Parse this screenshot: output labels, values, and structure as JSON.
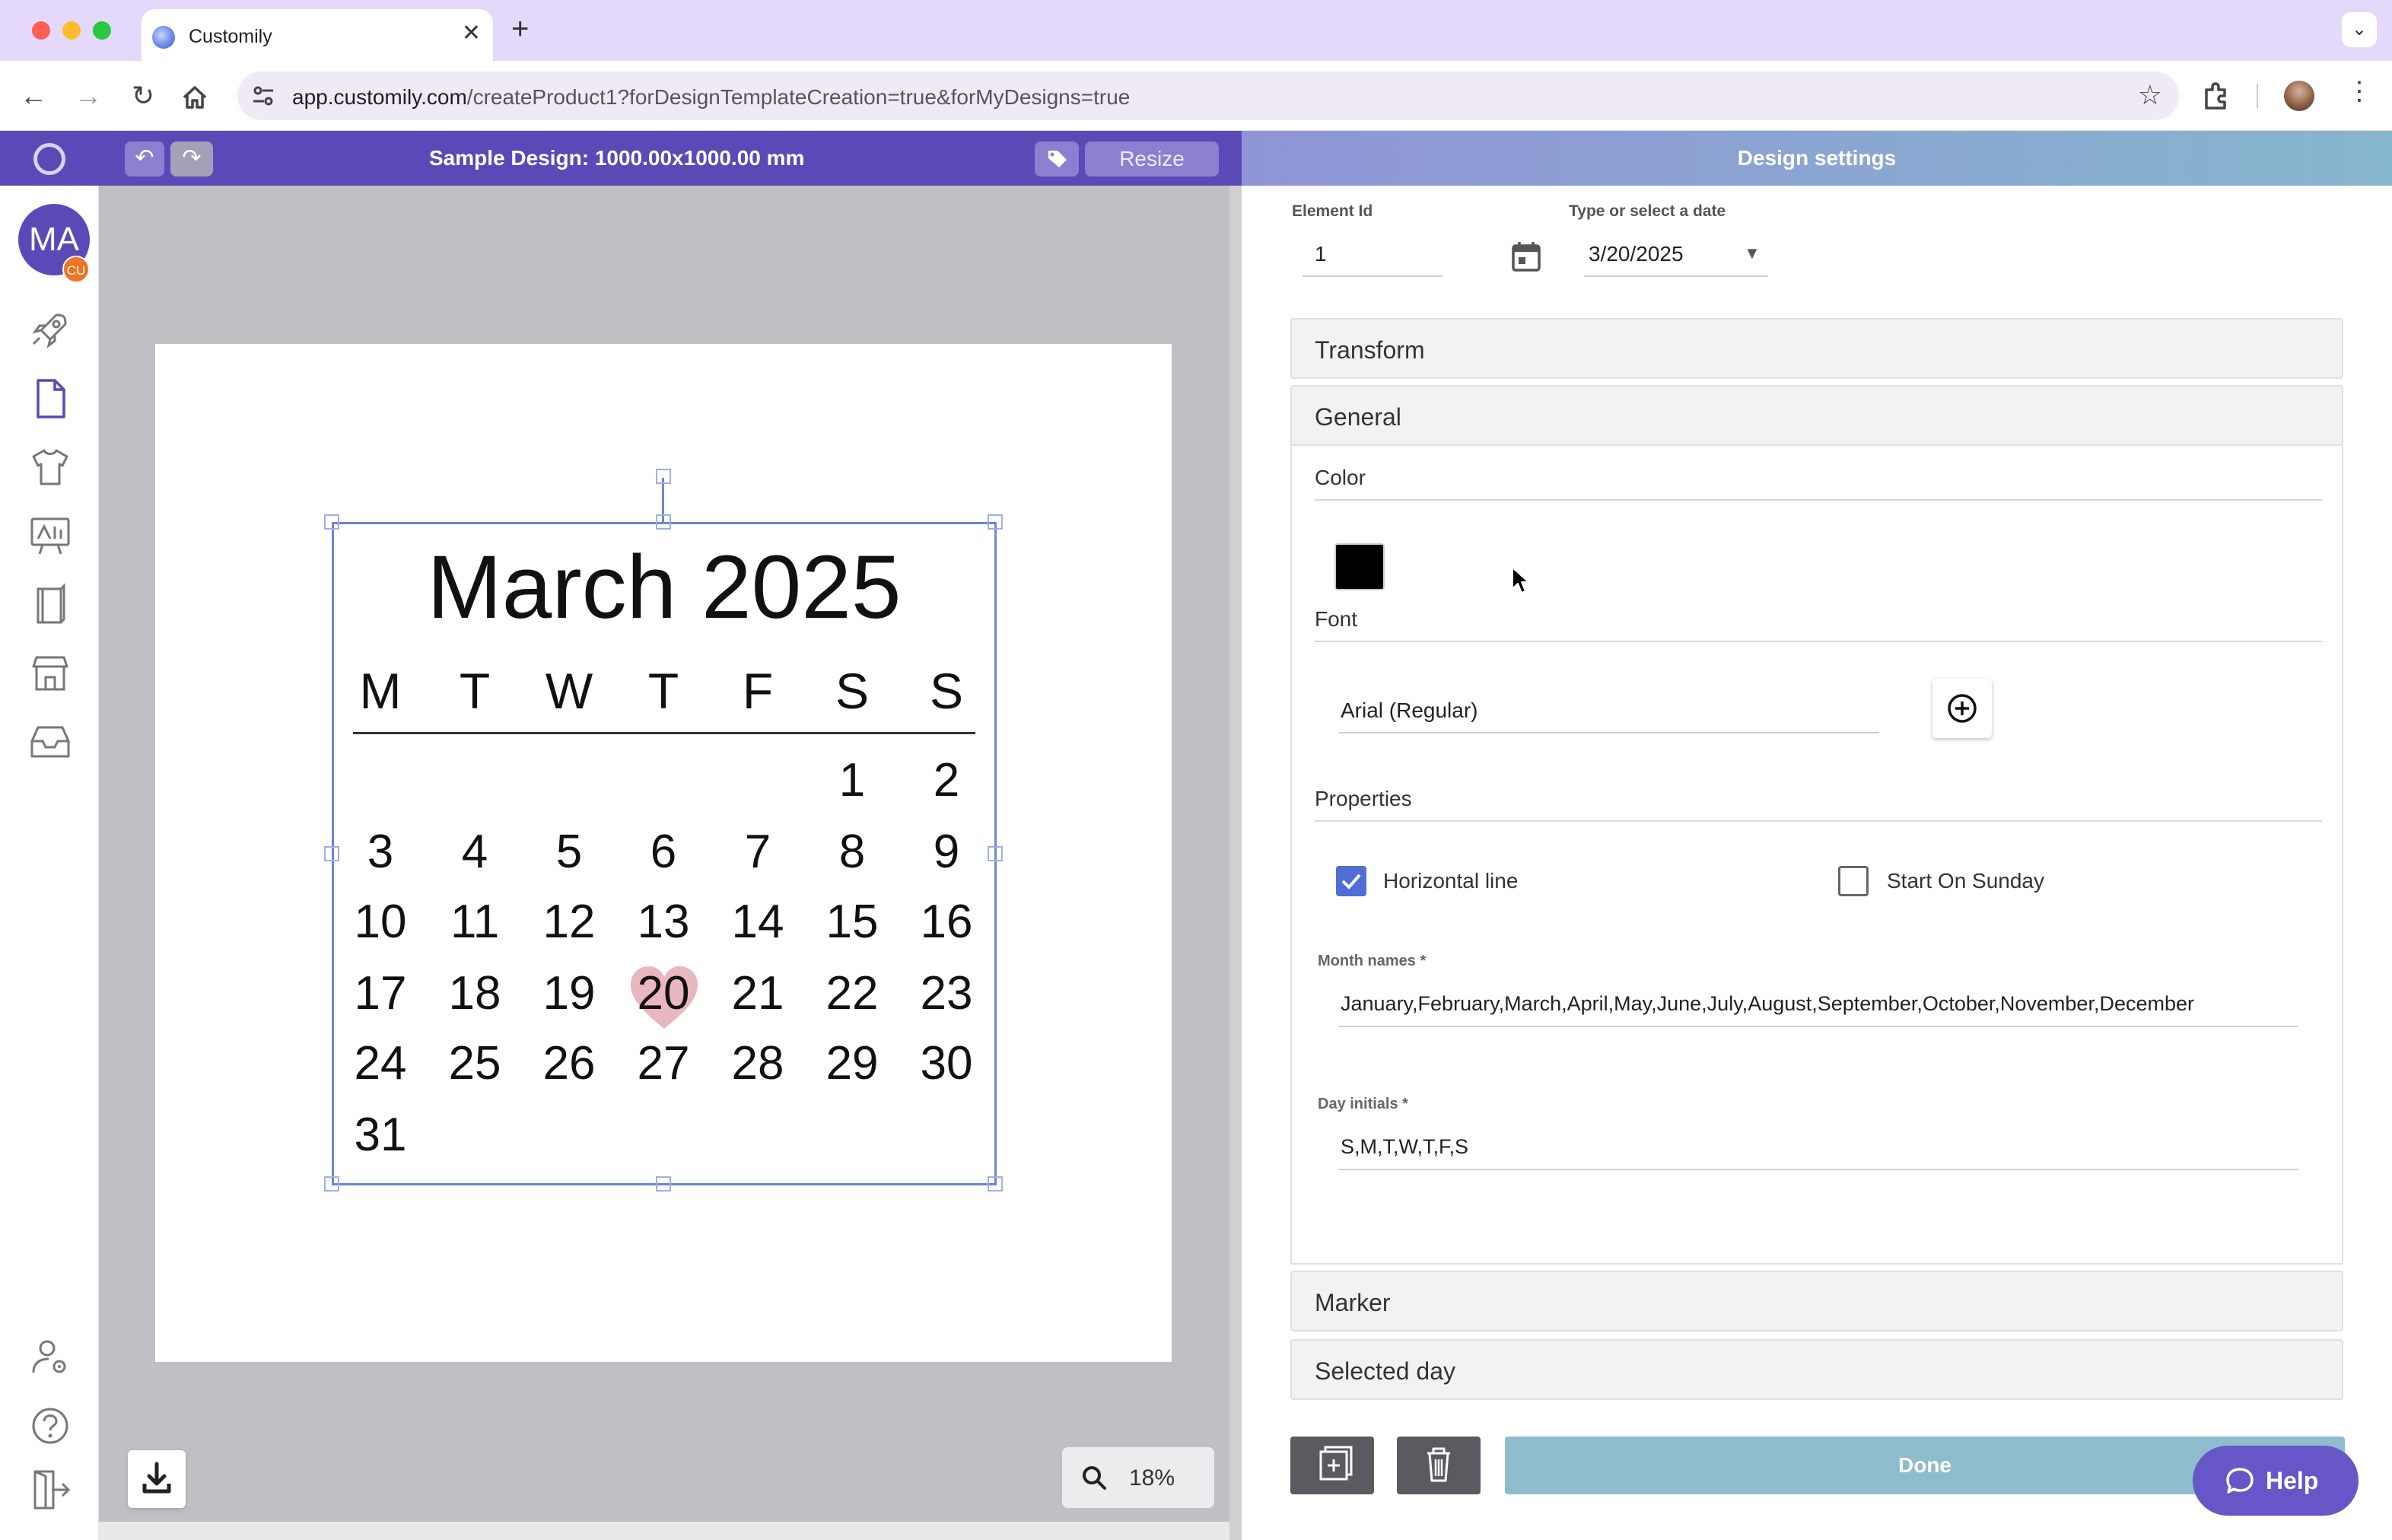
{
  "browser": {
    "tab_title": "Customily",
    "url_host": "app.customily.com",
    "url_path": "/createProduct1?forDesignTemplateCreation=true&forMyDesigns=true",
    "new_tab_symbol": "+",
    "tab_close_symbol": "✕"
  },
  "header": {
    "design_title": "Sample Design: 1000.00x1000.00 mm",
    "resize_label": "Resize",
    "settings_title": "Design settings"
  },
  "sidebar": {
    "avatar_initials": "MA",
    "avatar_badge": "CU",
    "items": [
      "rocket-icon",
      "document-icon",
      "tshirt-icon",
      "canvas-art-icon",
      "book-icon",
      "store-icon",
      "inbox-icon"
    ],
    "bottom_items": [
      "user-settings-icon",
      "help-circle-icon",
      "logout-icon"
    ]
  },
  "calendar": {
    "title": "March 2025",
    "day_initials": [
      "M",
      "T",
      "W",
      "T",
      "F",
      "S",
      "S"
    ],
    "weeks": [
      [
        "",
        "",
        "",
        "",
        "",
        "1",
        "2"
      ],
      [
        "3",
        "4",
        "5",
        "6",
        "7",
        "8",
        "9"
      ],
      [
        "10",
        "11",
        "12",
        "13",
        "14",
        "15",
        "16"
      ],
      [
        "17",
        "18",
        "19",
        "20",
        "21",
        "22",
        "23"
      ],
      [
        "24",
        "25",
        "26",
        "27",
        "28",
        "29",
        "30"
      ],
      [
        "31",
        "",
        "",
        "",
        "",
        "",
        ""
      ]
    ],
    "highlighted_day": "20",
    "highlight_color": "#e9b7c0"
  },
  "canvas": {
    "zoom": "18%"
  },
  "settings": {
    "element_id_label": "Element Id",
    "element_id_value": "1",
    "date_label": "Type or select a date",
    "date_value": "3/20/2025",
    "sections": {
      "transform": "Transform",
      "general": "General",
      "marker": "Marker",
      "selected_day": "Selected day"
    },
    "color_label": "Color",
    "color_value": "#000000",
    "font_label": "Font",
    "font_value": "Arial (Regular)",
    "properties_label": "Properties",
    "horizontal_line_label": "Horizontal line",
    "horizontal_line_checked": true,
    "start_on_sunday_label": "Start On Sunday",
    "start_on_sunday_checked": false,
    "month_names_label": "Month names *",
    "month_names_value": "January,February,March,April,May,June,July,August,September,October,November,December",
    "day_initials_label": "Day initials *",
    "day_initials_value": "S,M,T,W,T,F,S",
    "done_label": "Done",
    "help_label": "Help"
  },
  "colors": {
    "brand_purple": "#5b49b8",
    "checkbox_blue": "#4f6fd6",
    "done_teal": "#8fbccc",
    "help_purple": "#6656c8"
  }
}
